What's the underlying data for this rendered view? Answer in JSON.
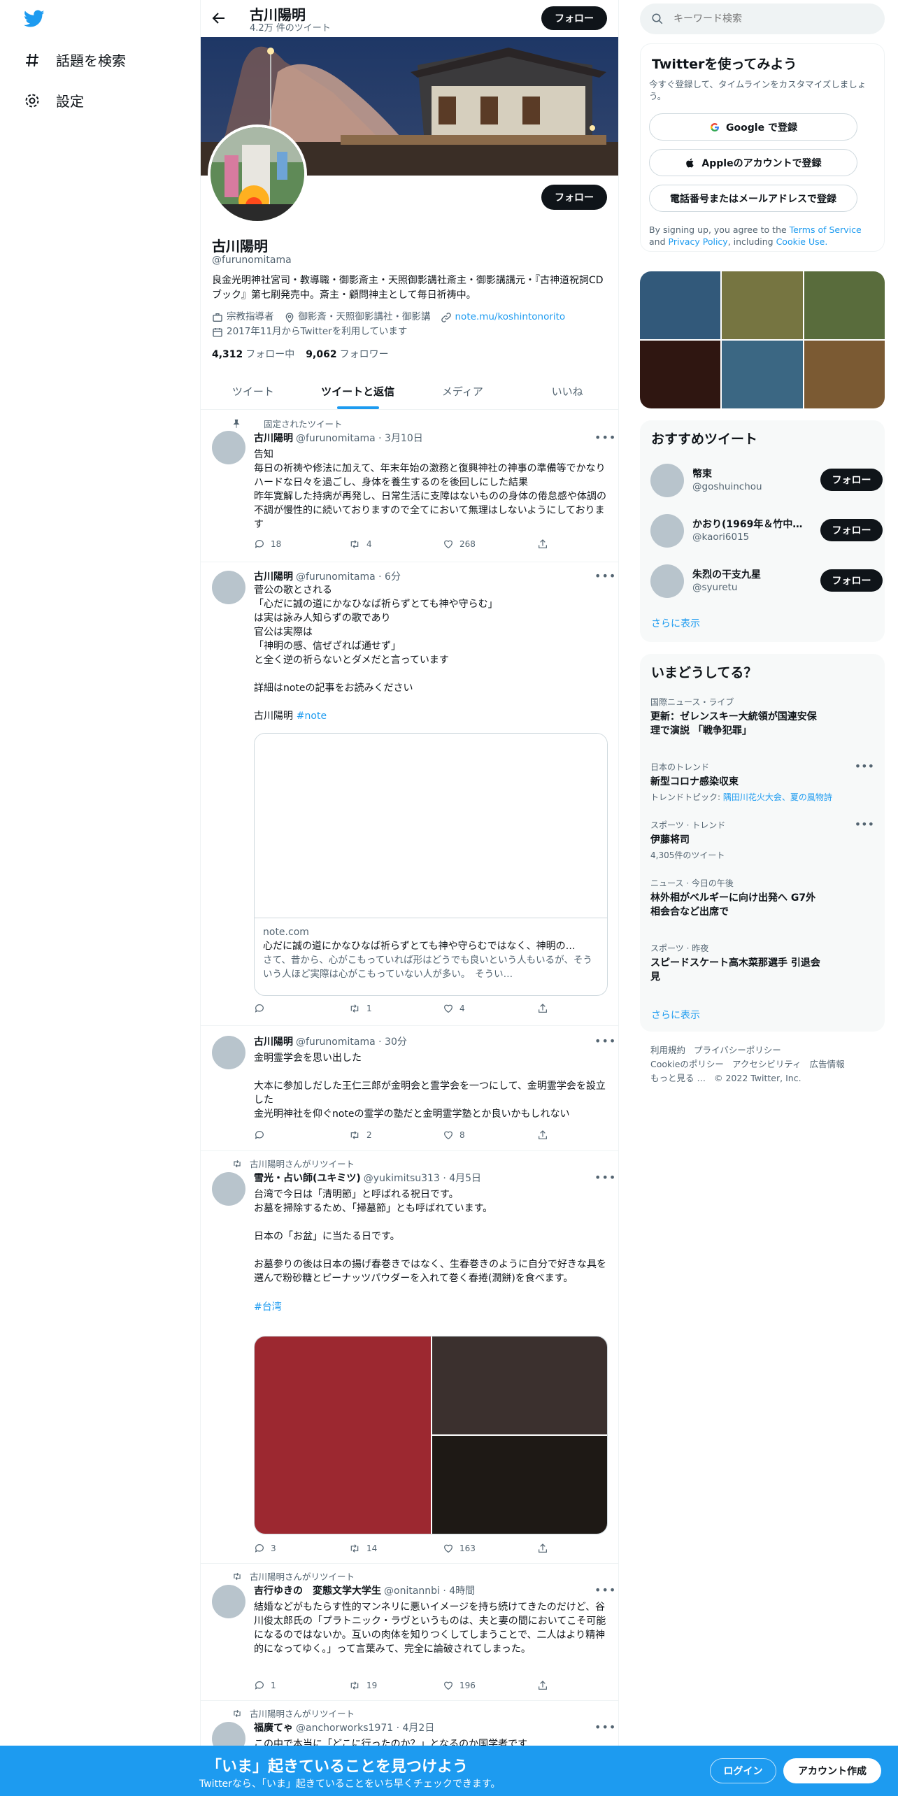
{
  "nav": {
    "explore": "話題を検索",
    "settings": "設定"
  },
  "header": {
    "name": "古川陽明",
    "tweet_count": "4.2万 件のツイート",
    "follow": "フォロー"
  },
  "profile": {
    "name": "古川陽明",
    "handle": "@furunomitama",
    "follow": "フォロー",
    "bio": "良金光明神社宮司・教導職・御影斎主・天照御影講社斎主・御影講講元・『古神道祝詞CDブック』第七刷発売中。斎主・顧問神主として毎日祈祷中。",
    "category": "宗教指導者",
    "location": "御影斎・天照御影講社・御影講",
    "url": "note.mu/koshintonorito",
    "joined": "2017年11月からTwitterを利用しています",
    "following_count": "4,312",
    "following_label": "フォロー中",
    "followers_count": "9,062",
    "followers_label": "フォロワー"
  },
  "tabs": [
    "ツイート",
    "ツイートと返信",
    "メディア",
    "いいね"
  ],
  "tweets": [
    {
      "context": "固定されたツイート",
      "name": "古川陽明",
      "handle": "@furunomitama",
      "time": "· 3月10日",
      "text": "告知\n毎日の祈祷や修法に加えて、年末年始の激務と復興神社の神事の準備等でかなりハードな日々を過ごし、身体を養生するのを後回しにした結果\n昨年寛解した持病が再発し、日常生活に支障はないものの身体の倦怠感や体調の不調が慢性的に続いておりますので全てにおいて無理はしないようにしております",
      "replies": "18",
      "retweets": "4",
      "likes": "268"
    },
    {
      "name": "古川陽明",
      "handle": "@furunomitama",
      "time": "· 6分",
      "text": "菅公の歌とされる\n「心だに誠の道にかなひなば祈らずとても神や守らむ」\nは実は詠み人知らずの歌であり\n官公は実際は\n「神明の感、信ぜざれば通せず」\nと全く逆の祈らないとダメだと言っています\n\n詳細はnoteの記事をお読みください\n\n古川陽明",
      "hashtag": "#note",
      "card": {
        "domain": "note.com",
        "title": "心だに誠の道にかなひなば祈らずとても神や守らむではなく、神明の…",
        "desc": "さて、昔から、心がこもっていれば形はどうでも良いという人もいるが、そういう人ほど実際は心がこもっていない人が多い。　そうい…"
      },
      "replies": "",
      "retweets": "1",
      "likes": "4"
    },
    {
      "name": "古川陽明",
      "handle": "@furunomitama",
      "time": "· 30分",
      "text": "金明霊学会を思い出した\n\n大本に参加しだした王仁三郎が金明会と霊学会を一つにして、金明霊学会を設立した\n金光明神社を仰ぐnoteの霊学の塾だと金明霊学塾とか良いかもしれない",
      "replies": "",
      "retweets": "2",
      "likes": "8"
    },
    {
      "context": "古川陽明さんがリツイート",
      "name": "雪光・占い師(ユキミツ)",
      "handle": "@yukimitsu313",
      "time": "· 4月5日",
      "text": "台湾で今日は「清明節」と呼ばれる祝日です。\nお墓を掃除するため、「掃墓節」とも呼ばれています。\n\n日本の「お盆」に当たる日です。\n\nお墓参りの後は日本の揚げ春巻きではなく、生春巻きのように自分で好きな具を選んで粉砂糖とピーナッツパウダーを入れて巻く春捲(潤餅)を食べます。",
      "hashtag": "#台湾",
      "replies": "3",
      "retweets": "14",
      "likes": "163"
    },
    {
      "context": "古川陽明さんがリツイート",
      "name": "吉行ゆきの　変態文学大学生",
      "handle": "@onitannbi",
      "time": "· 4時間",
      "text": "結婚などがもたらす性的マンネリに悪いイメージを持ち続けてきたのだけど、谷川俊太郎氏の「プラトニック・ラヴというものは、夫と妻の間においてこそ可能になるのではないか。互いの肉体を知りつくしてしまうことで、二人はより精神的になってゆく。」って言葉みて、完全に論破されてしまった。",
      "replies": "1",
      "retweets": "19",
      "likes": "196"
    },
    {
      "context": "古川陽明さんがリツイート",
      "name": "福廣てゃ",
      "handle": "@anchorworks1971",
      "time": "· 4月2日",
      "text": "この中で本当に「どこに行ったのか？」となるのか国学者です"
    }
  ],
  "right": {
    "search_placeholder": "キーワード検索",
    "signup_title": "Twitterを使ってみよう",
    "signup_sub": "今すぐ登録して、タイムラインをカスタマイズしましょう。",
    "google": "Google で登録",
    "apple": "Appleのアカウントで登録",
    "phone": "電話番号またはメールアドレスで登録",
    "terms_pre": "By signing up, you agree to the",
    "terms": "Terms of Service",
    "and": "and",
    "privacy": "Privacy Policy",
    "including": ", including",
    "cookie": "Cookie Use.",
    "recs_title": "おすすめツイート",
    "recs": [
      {
        "name": "幣束",
        "handle": "@goshuinchou"
      },
      {
        "name": "かおり(1969年＆竹中…",
        "handle": "@kaori6015"
      },
      {
        "name": "朱烈の干支九星",
        "handle": "@syuretu"
      }
    ],
    "rec_follow": "フォロー",
    "show_more": "さらに表示",
    "trends_title": "いまどうしてる？",
    "trends": [
      {
        "context": "国際ニュース・ライブ",
        "title": "更新：ゼレンスキー大統領が国連安保理で演説 「戦争犯罪」"
      },
      {
        "context": "日本のトレンド",
        "title": "新型コロナ感染収束",
        "sub_pre": "トレンドトピック: ",
        "sub_links": "隅田川花火大会、夏の風物詩"
      },
      {
        "context": "スポーツ · トレンド",
        "title": "伊藤将司",
        "sub": "4,305件のツイート"
      },
      {
        "context": "ニュース · 今日の午後",
        "title": "林外相がベルギーに向け出発へ G7外相会合など出席で"
      },
      {
        "context": "スポーツ · 昨夜",
        "title": "スピードスケート高木菜那選手 引退会見"
      }
    ],
    "footer": [
      "利用規約",
      "プライバシーポリシー",
      "Cookieのポリシー",
      "アクセシビリティ",
      "広告情報",
      "もっと見る …",
      "© 2022 Twitter, Inc."
    ]
  },
  "bottom": {
    "title": "「いま」起きていることを見つけよう",
    "sub": "Twitterなら、「いま」起きていることをいち早くチェックできます。",
    "login": "ログイン",
    "signup": "アカウント作成"
  },
  "colors": {
    "accent": "#1d9bf0",
    "text": "#0f1419",
    "muted": "#536471"
  }
}
